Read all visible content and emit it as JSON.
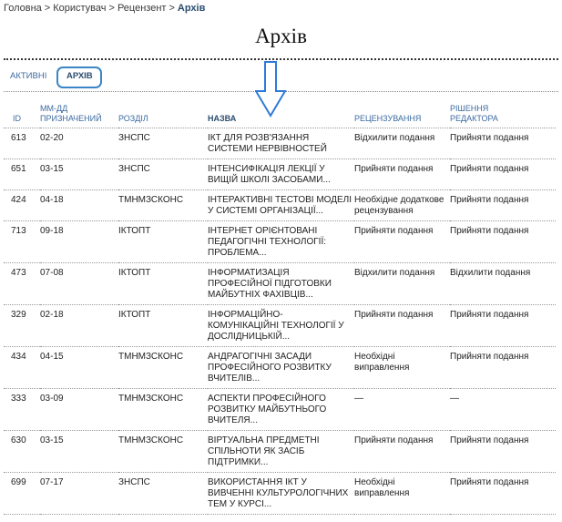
{
  "breadcrumb": {
    "items": [
      "Головна",
      "Користувач",
      "Рецензент"
    ],
    "separator": ">",
    "current": "Архів"
  },
  "page": {
    "title": "Архів"
  },
  "tabs": {
    "active": "АКТИВНІ",
    "archive": "АРХІВ"
  },
  "table": {
    "headers": {
      "id": "ID",
      "date_line1": "ММ-ДД",
      "date_line2": "ПРИЗНАЧЕНИЙ",
      "section": "РОЗДІЛ",
      "title": "НАЗВА",
      "review": "РЕЦЕНЗУВАННЯ",
      "decision_line1": "РІШЕННЯ",
      "decision_line2": "РЕДАКТОРА"
    },
    "rows": [
      {
        "id": "613",
        "date": "02-20",
        "section": "ЗНСПС",
        "title": "ІКТ для розв'язання системи нервівностей",
        "review": "Відхилити подання",
        "decision": "Прийняти подання"
      },
      {
        "id": "651",
        "date": "03-15",
        "section": "ЗНСПС",
        "title": "Інтенсифікація лекції у вищій школі засобами...",
        "review": "Прийняти подання",
        "decision": "Прийняти подання"
      },
      {
        "id": "424",
        "date": "04-18",
        "section": "ТМНМЗСКОНС",
        "title": "Інтерактивні тестові моделі у системі організації...",
        "review": "Необхідне додаткове рецензування",
        "decision": "Прийняти подання"
      },
      {
        "id": "713",
        "date": "09-18",
        "section": "ІКТОПТ",
        "title": "Інтернет орієнтовані педагогічні технології: проблема...",
        "review": "Прийняти подання",
        "decision": "Прийняти подання"
      },
      {
        "id": "473",
        "date": "07-08",
        "section": "ІКТОПТ",
        "title": "Інформатизація професійної підготовки майбутніх фахівців...",
        "review": "Відхилити подання",
        "decision": "Відхилити подання"
      },
      {
        "id": "329",
        "date": "02-18",
        "section": "ІКТОПТ",
        "title": "Інформаційно-комунікаційні технології у дослідницькій...",
        "review": "Прийняти подання",
        "decision": "Прийняти подання"
      },
      {
        "id": "434",
        "date": "04-15",
        "section": "ТМНМЗСКОНС",
        "title": "Андрагогічні засади професійного розвитку вчителів...",
        "review": "Необхідні виправлення",
        "decision": "Прийняти подання"
      },
      {
        "id": "333",
        "date": "03-09",
        "section": "ТМНМЗСКОНС",
        "title": "Аспекти професійного розвитку майбутнього вчителя...",
        "review": "—",
        "decision": "—"
      },
      {
        "id": "630",
        "date": "03-15",
        "section": "ТМНМЗСКОНС",
        "title": "Віртуальна предметні спільноти як засіб підтримки...",
        "review": "Прийняти подання",
        "decision": "Прийняти подання"
      },
      {
        "id": "699",
        "date": "07-17",
        "section": "ЗНСПС",
        "title": "Використання ІКТ у вивченні культурологічних тем у курсі...",
        "review": "Необхідні виправлення",
        "decision": "Прийняти подання"
      }
    ]
  },
  "annotation": {
    "icon": "down-arrow-icon",
    "color": "#2e7bd6"
  },
  "colors": {
    "link": "#3b6aa0",
    "current": "#2a4d6e",
    "tab_outline": "#3a86c7"
  }
}
